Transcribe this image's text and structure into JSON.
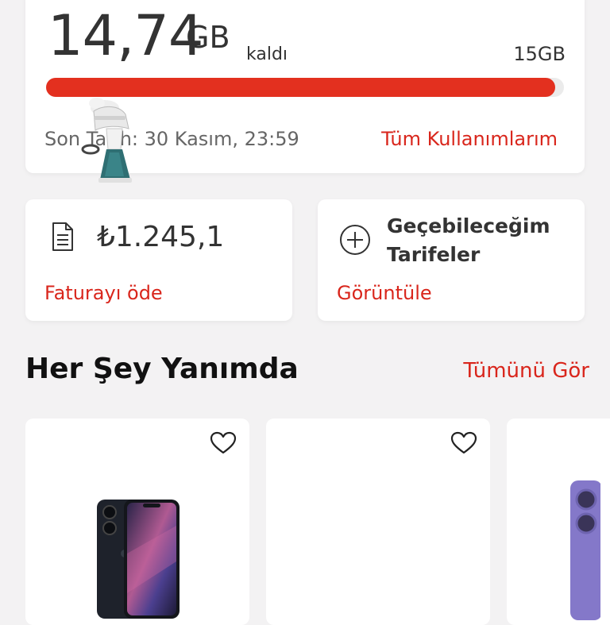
{
  "usage": {
    "amount": "14,74",
    "unit": "GB",
    "remaining_label": "kaldı",
    "total": "15GB",
    "used_fraction": 0.983,
    "deadline": "Son Tarih: 30 Kasım, 23:59",
    "all_usage_link": "Tüm Kullanımlarım"
  },
  "bill": {
    "amount": "₺1.245,1",
    "pay_link": "Faturayı öde",
    "icon": "document-icon"
  },
  "tariffs": {
    "title": "Geçebileceğim Tarifeler",
    "view_link": "Görüntüle",
    "icon": "plus-circle-icon"
  },
  "section": {
    "title": "Her Şey Yanımda",
    "see_all_link": "Tümünü Gör"
  },
  "products": [
    {
      "icon": "heart-icon",
      "image": "smartphone-image"
    },
    {
      "icon": "heart-icon",
      "image": "garment-steamer-image"
    },
    {
      "image": "smartphone-image"
    }
  ],
  "colors": {
    "accent": "#d9261c",
    "bar": "#e3301f",
    "background": "#f3f2f3"
  }
}
